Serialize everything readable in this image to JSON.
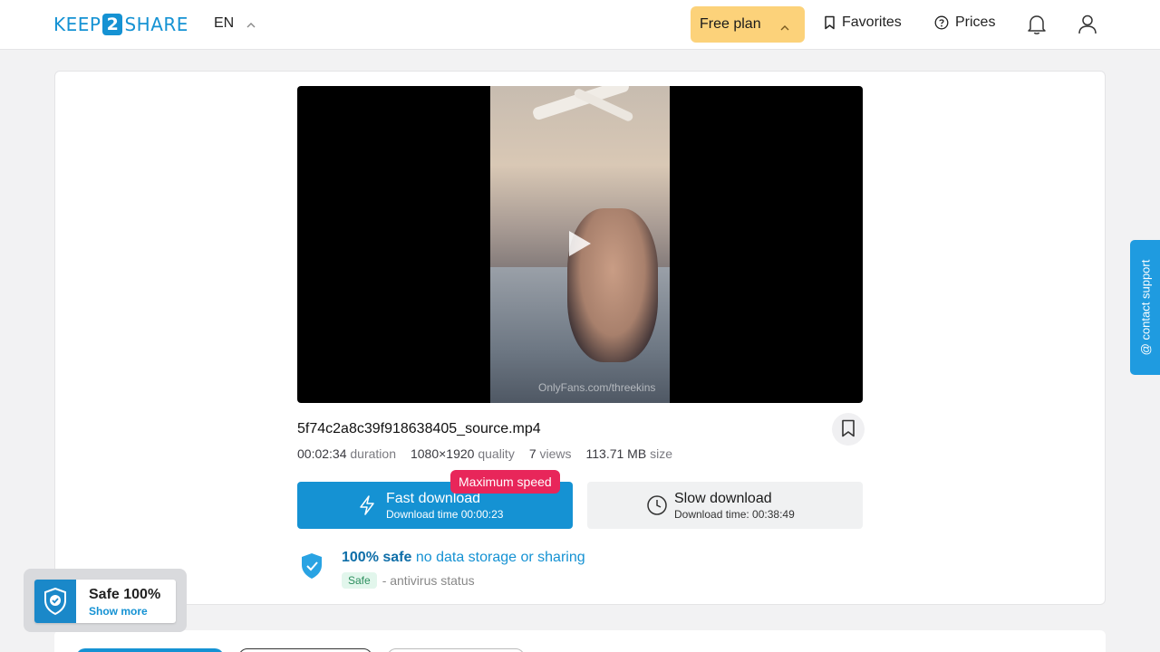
{
  "header": {
    "logo_left": "KEEP",
    "logo_mid": "2",
    "logo_right": "SHARE",
    "language": "EN",
    "plan_label": "Free plan",
    "favorites_label": "Favorites",
    "prices_label": "Prices"
  },
  "video": {
    "watermark": "OnlyFans.com/threekins"
  },
  "file": {
    "name": "5f74c2a8c39f918638405_source.mp4",
    "duration_value": "00:02:34",
    "duration_label": "duration",
    "quality_value": "1080×1920",
    "quality_label": "quality",
    "views_value": "7",
    "views_label": "views",
    "size_value": "113.71 MB",
    "size_label": "size"
  },
  "download": {
    "badge": "Maximum speed",
    "fast_title": "Fast download",
    "fast_sub": "Download time 00:00:23",
    "slow_title": "Slow download",
    "slow_sub": "Download time: 00:38:49"
  },
  "safety": {
    "bold": "100% safe",
    "rest": "no data storage or sharing",
    "pill": "Safe",
    "status": "- antivirus status"
  },
  "support": {
    "label": "@ contact support"
  },
  "widget": {
    "title": "Safe 100%",
    "link": "Show more"
  },
  "colors": {
    "accent": "#1592d3",
    "plan": "#fcd27a",
    "badge": "#e8265a",
    "support": "#1f9be0"
  }
}
